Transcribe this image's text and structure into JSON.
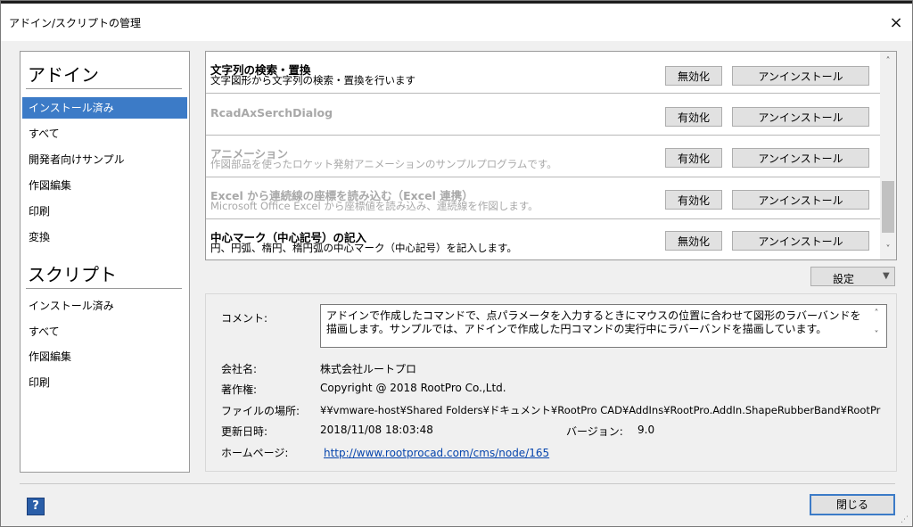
{
  "window": {
    "title": "アドイン/スクリプトの管理",
    "close_icon": "×"
  },
  "left": {
    "addin_header": "アドイン",
    "addin_items": [
      "インストール済み",
      "すべて",
      "開発者向けサンプル",
      "作図編集",
      "印刷",
      "変換"
    ],
    "script_header": "スクリプト",
    "script_items": [
      "インストール済み",
      "すべて",
      "作図編集",
      "印刷"
    ]
  },
  "addins": [
    {
      "name": "文字列の検索・置換",
      "desc": "文字図形から文字列の検索・置換を行います",
      "toggle": "無効化",
      "uninstall": "アンインストール",
      "enabled": true
    },
    {
      "name": "RcadAxSerchDialog",
      "desc": "",
      "toggle": "有効化",
      "uninstall": "アンインストール",
      "enabled": false
    },
    {
      "name": "アニメーション",
      "desc": "作図部品を使ったロケット発射アニメーションのサンプルプログラムです。",
      "toggle": "有効化",
      "uninstall": "アンインストール",
      "enabled": false
    },
    {
      "name": "Excel から連続線の座標を読み込む（Excel 連携）",
      "desc": "Microsoft Office Excel から座標値を読み込み、連続線を作図します。",
      "toggle": "有効化",
      "uninstall": "アンインストール",
      "enabled": false
    },
    {
      "name": "中心マーク（中心記号）の記入",
      "desc": "円、円弧、楕円、楕円弧の中心マーク（中心記号）を記入します。",
      "toggle": "無効化",
      "uninstall": "アンインストール",
      "enabled": true
    }
  ],
  "settings_button": {
    "label": "設定",
    "arrow": "▼"
  },
  "details": {
    "comment_label": "コメント:",
    "comment": "アドインで作成したコマンドで、点パラメータを入力するときにマウスの位置に合わせて図形のラバーバンドを描画します。サンプルでは、アドインで作成した円コマンドの実行中にラバーバンドを描画しています。",
    "company_label": "会社名:",
    "company": "株式会社ルートプロ",
    "copyright_label": "著作権:",
    "copyright": "Copyright @ 2018 RootPro Co.,Ltd.",
    "location_label": "ファイルの場所:",
    "location": "¥¥vmware-host¥Shared Folders¥ドキュメント¥RootPro CAD¥AddIns¥RootPro.AddIn.ShapeRubberBand¥RootPr",
    "updated_label": "更新日時:",
    "updated": "2018/11/08 18:03:48",
    "version_label": "バージョン:",
    "version": "9.0",
    "homepage_label": "ホームページ:",
    "homepage": "http://www.rootprocad.com/cms/node/165"
  },
  "footer": {
    "help_label": "?",
    "close_label": "閉じる"
  },
  "scroll": {
    "up": "˄",
    "down": "˅"
  }
}
